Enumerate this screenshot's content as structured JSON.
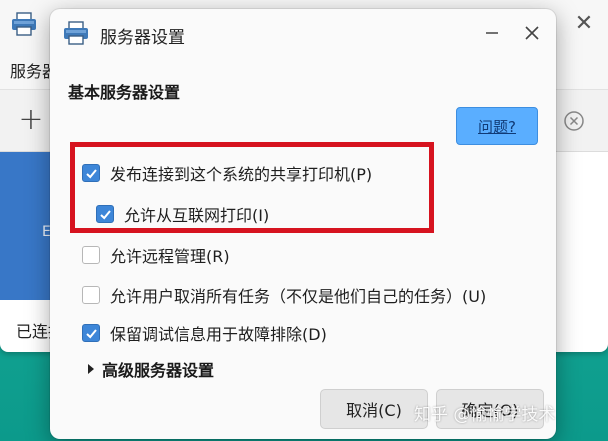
{
  "background_window": {
    "menu_server": "服务器",
    "status_text": "已连接",
    "tile_letter": "E",
    "add_symbol": "+",
    "close_symbol": "✕"
  },
  "dialog": {
    "title": "服务器设置",
    "section_heading": "基本服务器设置",
    "help_label": "问题?",
    "options": [
      {
        "label": "发布连接到这个系统的共享打印机(P)",
        "checked": true
      },
      {
        "label": "允许从互联网打印(I)",
        "checked": true
      },
      {
        "label": "允许远程管理(R)",
        "checked": false
      },
      {
        "label": "允许用户取消所有任务（不仅是他们自己的任务）(U)",
        "checked": false
      },
      {
        "label": "保留调试信息用于故障排除(D)",
        "checked": true
      }
    ],
    "advanced_label": "高级服务器设置",
    "cancel_label": "取消(C)",
    "ok_label": "确定(O)"
  },
  "watermark": "知乎 @愉愉学技术",
  "colors": {
    "checkbox_checked": "#3d86d8",
    "help_button": "#5aaeff",
    "highlight_box": "#d6131f",
    "desktop": "#14a795",
    "printer_tile": "#3877c7"
  },
  "icons": [
    "printer-icon",
    "minimize-icon",
    "close-icon",
    "clear-icon",
    "add-icon",
    "disclosure-triangle-icon",
    "checkmark-icon"
  ]
}
